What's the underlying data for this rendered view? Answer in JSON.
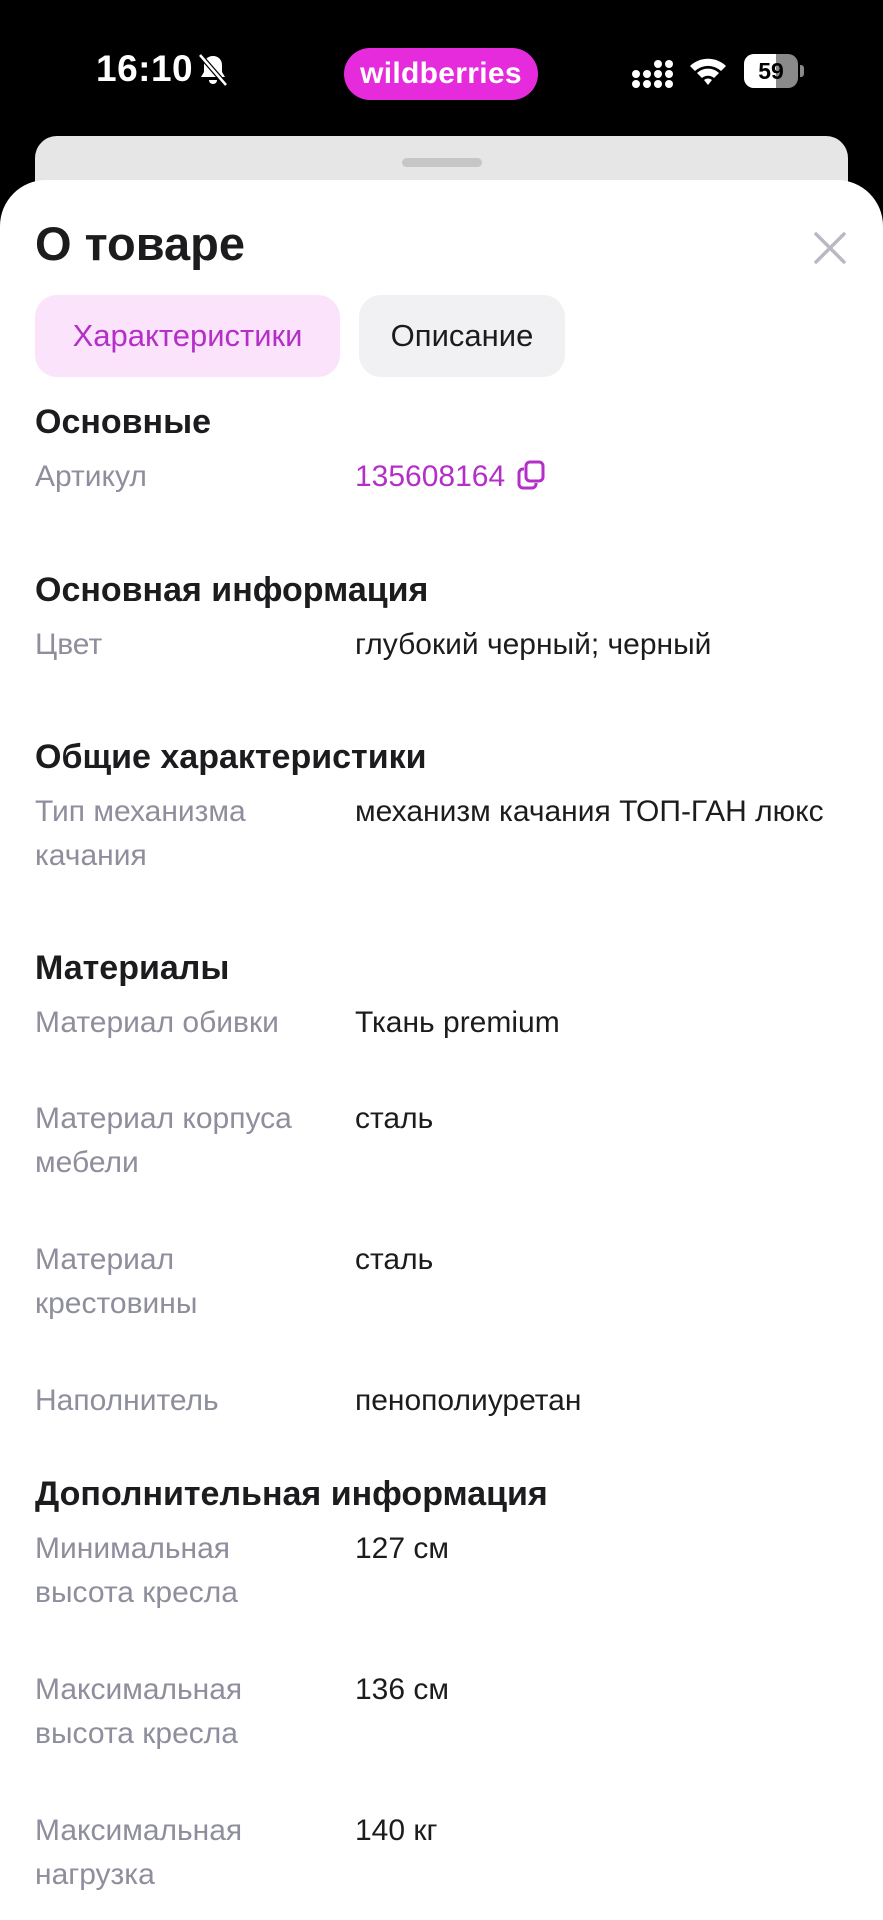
{
  "status_bar": {
    "time": "16:10",
    "app_label": "wildberries",
    "battery_level": "59",
    "battery_fraction": 0.59,
    "accent_color": "#e52bdc"
  },
  "sheet": {
    "title": "О товаре",
    "tabs": [
      {
        "label": "Характеристики",
        "active": true
      },
      {
        "label": "Описание",
        "active": false
      }
    ],
    "accent_color": "#b42fc8"
  },
  "sections": [
    {
      "title": "Основные",
      "rows": [
        {
          "label": "Артикул",
          "value": "135608164"
        }
      ]
    },
    {
      "title": "Основная информация",
      "rows": [
        {
          "label": "Цвет",
          "value": "глубокий черный; черный"
        }
      ]
    },
    {
      "title": "Общие характеристики",
      "rows": [
        {
          "label": "Тип механизма качания",
          "value": "механизм качания ТОП-ГАН люкс"
        }
      ]
    },
    {
      "title": "Материалы",
      "rows": [
        {
          "label": "Материал обивки",
          "value": "Ткань premium"
        },
        {
          "label": "Материал корпуса мебели",
          "value": "сталь"
        },
        {
          "label": "Материал крестовины",
          "value": "сталь"
        },
        {
          "label": "Наполнитель",
          "value": "пенополиуретан"
        }
      ]
    },
    {
      "title": "Дополнительная информация",
      "rows": [
        {
          "label": "Минимальная высота кресла",
          "value": "127 см"
        },
        {
          "label": "Максимальная высота кресла",
          "value": "136 см"
        },
        {
          "label": "Максимальная нагрузка",
          "value": "140 кг"
        }
      ]
    }
  ],
  "icons": {
    "bell": "bell-slash-icon",
    "signal": "cellular-signal-icon",
    "wifi": "wifi-icon",
    "copy": "copy-icon",
    "close": "close-icon"
  }
}
